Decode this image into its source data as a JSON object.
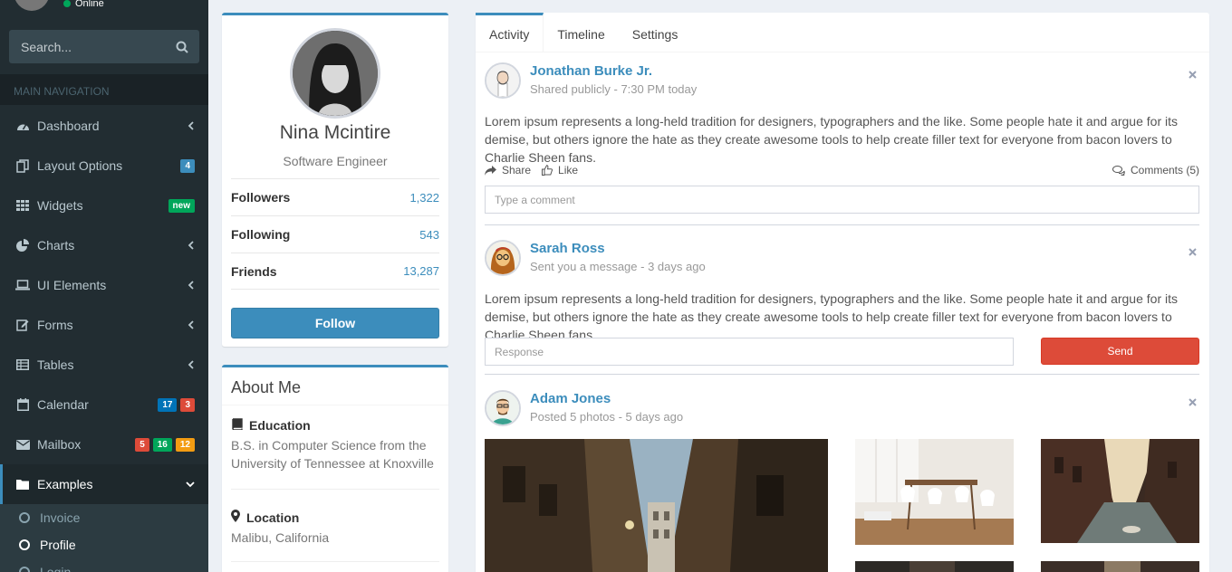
{
  "sidebar": {
    "status": "Online",
    "search_placeholder": "Search...",
    "nav_header": "MAIN NAVIGATION",
    "items": [
      {
        "label": "Dashboard"
      },
      {
        "label": "Layout Options",
        "badges": [
          "4"
        ]
      },
      {
        "label": "Widgets",
        "badges": [
          "new"
        ]
      },
      {
        "label": "Charts"
      },
      {
        "label": "UI Elements"
      },
      {
        "label": "Forms"
      },
      {
        "label": "Tables"
      },
      {
        "label": "Calendar",
        "badges": [
          "17",
          "3"
        ]
      },
      {
        "label": "Mailbox",
        "badges": [
          "5",
          "16",
          "12"
        ]
      },
      {
        "label": "Examples"
      }
    ],
    "sub_items": [
      {
        "label": "Invoice"
      },
      {
        "label": "Profile"
      },
      {
        "label": "Login"
      }
    ]
  },
  "profile": {
    "name": "Nina Mcintire",
    "role": "Software Engineer",
    "stats": [
      {
        "label": "Followers",
        "value": "1,322"
      },
      {
        "label": "Following",
        "value": "543"
      },
      {
        "label": "Friends",
        "value": "13,287"
      }
    ],
    "follow_label": "Follow"
  },
  "about": {
    "title": "About Me",
    "education_head": "Education",
    "education_text": "B.S. in Computer Science from the University of Tennessee at Knoxville",
    "location_head": "Location",
    "location_text": "Malibu, California"
  },
  "tabs": [
    {
      "label": "Activity"
    },
    {
      "label": "Timeline"
    },
    {
      "label": "Settings"
    }
  ],
  "posts": [
    {
      "name": "Jonathan Burke Jr.",
      "desc": "Shared publicly - 7:30 PM today",
      "body": "Lorem ipsum represents a long-held tradition for designers, typographers and the like. Some people hate it and argue for its demise, but others ignore the hate as they create awesome tools to help create filler text for everyone from bacon lovers to Charlie Sheen fans.",
      "share": "Share",
      "like": "Like",
      "comments": "Comments (5)",
      "comment_placeholder": "Type a comment"
    },
    {
      "name": "Sarah Ross",
      "desc": "Sent you a message - 3 days ago",
      "body": "Lorem ipsum represents a long-held tradition for designers, typographers and the like. Some people hate it and argue for its demise, but others ignore the hate as they create awesome tools to help create filler text for everyone from bacon lovers to Charlie Sheen fans.",
      "response_placeholder": "Response",
      "send": "Send"
    },
    {
      "name": "Adam Jones",
      "desc": "Posted 5 photos - 5 days ago"
    }
  ],
  "colors": {
    "accent": "#3c8dbc",
    "sidebar_bg": "#222d32",
    "danger": "#dd4b39",
    "success": "#00a65a",
    "warning": "#f39c12"
  }
}
